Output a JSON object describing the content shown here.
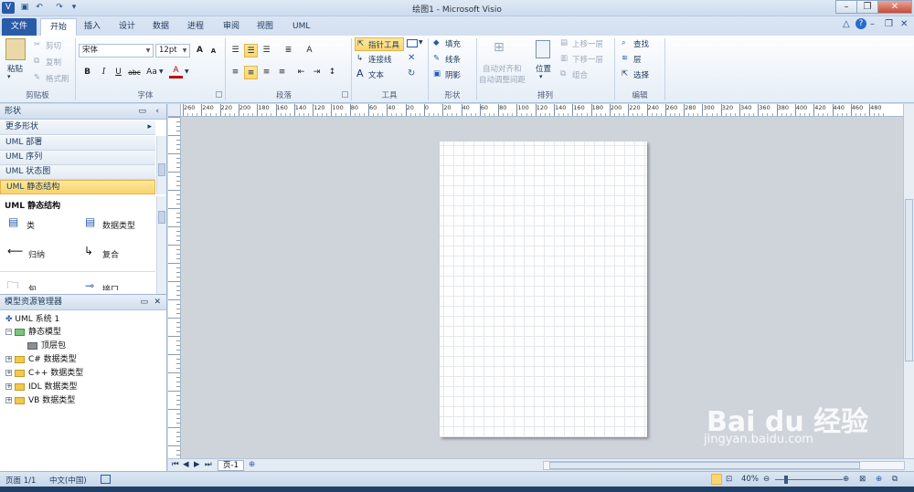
{
  "window": {
    "title": "绘图1 - Microsoft Visio",
    "zoom": "40%"
  },
  "tabs": [
    "文件",
    "开始",
    "插入",
    "设计",
    "数据",
    "进程",
    "审阅",
    "视图",
    "UML"
  ],
  "ribbon": {
    "clipboard": {
      "paste": "粘贴",
      "cut": "剪切",
      "copy": "复制",
      "format_painter": "格式刷",
      "label": "剪贴板"
    },
    "font": {
      "name": "宋体",
      "size": "12pt",
      "label": "字体",
      "bold": "B",
      "italic": "I",
      "underline": "U",
      "strike": "abc",
      "case": "Aa",
      "grow": "A",
      "shrink": "A",
      "color": "A"
    },
    "paragraph": {
      "label": "段落"
    },
    "tools": {
      "pointer": "指针工具",
      "connector": "连接线",
      "text": "文本",
      "label": "工具"
    },
    "shape": {
      "fill": "填充",
      "line": "线条",
      "shadow": "阴影",
      "label": "形状"
    },
    "arrange": {
      "auto_align": "自动对齐和",
      "auto_space": "自动调整间距",
      "position": "位置",
      "bring_forward": "上移一层",
      "send_backward": "下移一层",
      "group": "组合",
      "label": "排列"
    },
    "editing": {
      "find": "查找",
      "layers": "层",
      "select": "选择",
      "label": "编辑"
    }
  },
  "shapes_pane": {
    "title": "形状",
    "more_shapes": "更多形状",
    "stencils": [
      "UML 部署",
      "UML 序列",
      "UML 状态图",
      "UML 静态结构"
    ],
    "selected_stencil": "UML 静态结构",
    "section_title": "UML 静态结构",
    "items": [
      "类",
      "数据类型",
      "归纳",
      "复合",
      "包",
      "接口"
    ]
  },
  "model_pane": {
    "title": "模型资源管理器",
    "root": "UML 系统 1",
    "static_model": "静态模型",
    "top_package": "顶层包",
    "types": [
      "C# 数据类型",
      "C++ 数据类型",
      "IDL 数据类型",
      "VB 数据类型"
    ]
  },
  "ruler_ticks": [
    "260",
    "240",
    "220",
    "200",
    "180",
    "160",
    "140",
    "120",
    "100",
    "80",
    "60",
    "40",
    "20",
    "0",
    "20",
    "40",
    "60",
    "80",
    "100",
    "120",
    "140",
    "160",
    "180",
    "200",
    "220",
    "240",
    "260",
    "280",
    "300",
    "320",
    "340",
    "360",
    "380",
    "400",
    "420",
    "440",
    "460",
    "480"
  ],
  "page_tab": "页-1",
  "status": {
    "page": "页面 1/1",
    "language": "中文(中国)",
    "zoom": "40%"
  },
  "watermark": {
    "logo": "Bai du 经验",
    "url": "jingyan.baidu.com"
  }
}
